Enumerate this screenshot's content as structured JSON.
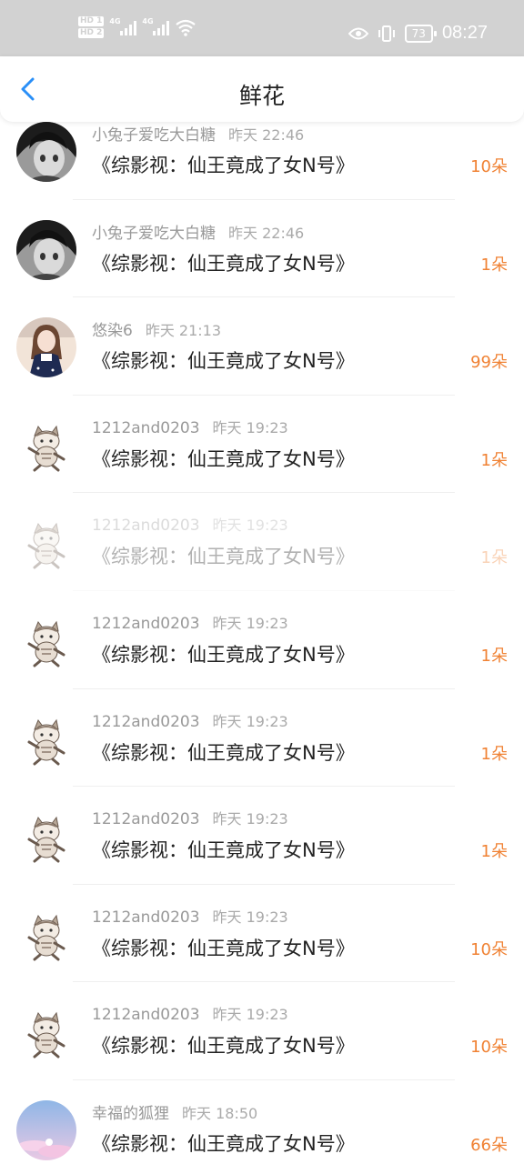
{
  "status_bar": {
    "hd1": "HD 1",
    "hd2": "HD 2",
    "network1": "4G",
    "network2": "4G",
    "battery": "73",
    "time": "08:27",
    "icons": [
      "eye-icon",
      "vibrate-icon",
      "wifi-icon",
      "battery-icon"
    ]
  },
  "header": {
    "back_icon": "chevron-left-icon",
    "title": "鲜花",
    "accent_color": "#2a8ff7"
  },
  "colors": {
    "amount": "#f08234",
    "name": "#999999",
    "text": "#222222"
  },
  "rows": [
    {
      "user": "小兔子爱吃大白糖",
      "time": "昨天 22:46",
      "book": "《综影视：仙王竟成了女N号》",
      "amount": "10朵",
      "avatar": "anime-boy-avatar"
    },
    {
      "user": "小兔子爱吃大白糖",
      "time": "昨天 22:46",
      "book": "《综影视：仙王竟成了女N号》",
      "amount": "1朵",
      "avatar": "anime-boy-avatar"
    },
    {
      "user": "悠染6",
      "time": "昨天 21:13",
      "book": "《综影视：仙王竟成了女N号》",
      "amount": "99朵",
      "avatar": "girl-photo-avatar"
    },
    {
      "user": "1212and0203",
      "time": "昨天 19:23",
      "book": "《综影视：仙王竟成了女N号》",
      "amount": "1朵",
      "avatar": "cat-avatar"
    },
    {
      "user": "1212and0203",
      "time": "昨天 19:23",
      "book": "《综影视：仙王竟成了女N号》",
      "amount": "1朵",
      "avatar": "cat-avatar"
    },
    {
      "user": "1212and0203",
      "time": "昨天 19:23",
      "book": "《综影视：仙王竟成了女N号》",
      "amount": "1朵",
      "avatar": "cat-avatar"
    },
    {
      "user": "1212and0203",
      "time": "昨天 19:23",
      "book": "《综影视：仙王竟成了女N号》",
      "amount": "1朵",
      "avatar": "cat-avatar"
    },
    {
      "user": "1212and0203",
      "time": "昨天 19:23",
      "book": "《综影视：仙王竟成了女N号》",
      "amount": "1朵",
      "avatar": "cat-avatar"
    },
    {
      "user": "1212and0203",
      "time": "昨天 19:23",
      "book": "《综影视：仙王竟成了女N号》",
      "amount": "10朵",
      "avatar": "cat-avatar"
    },
    {
      "user": "1212and0203",
      "time": "昨天 19:23",
      "book": "《综影视：仙王竟成了女N号》",
      "amount": "10朵",
      "avatar": "cat-avatar"
    },
    {
      "user": "幸福的狐狸",
      "time": "昨天 18:50",
      "book": "《综影视：仙王竟成了女N号》",
      "amount": "66朵",
      "avatar": "sky-avatar"
    }
  ]
}
